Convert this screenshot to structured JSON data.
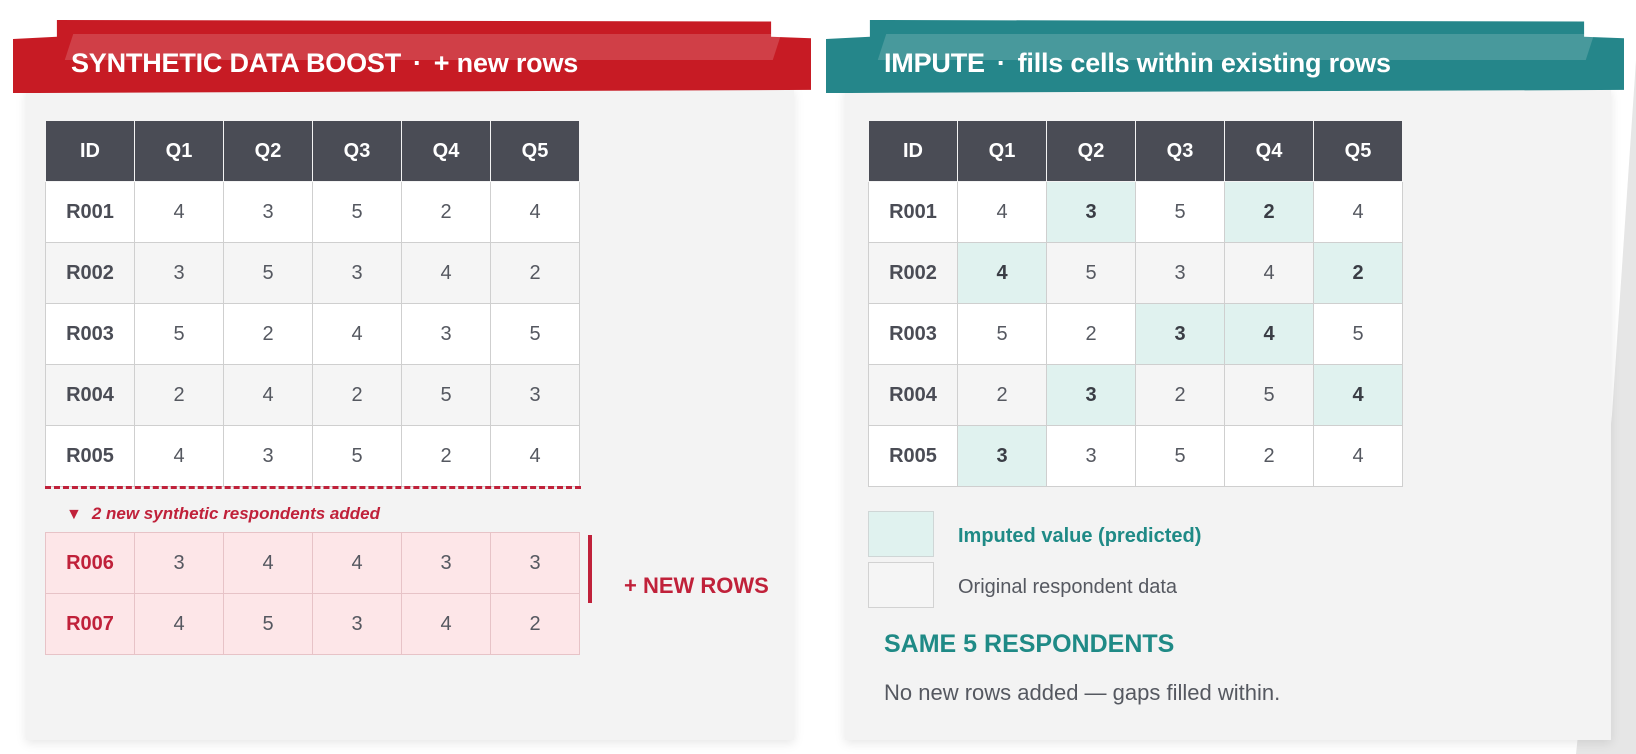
{
  "left": {
    "title": "SYNTHETIC DATA BOOST",
    "separator": "·",
    "subtitle": "+ new rows",
    "color": "#c71b24",
    "headers": [
      "ID",
      "Q1",
      "Q2",
      "Q3",
      "Q4",
      "Q5"
    ],
    "rows": [
      {
        "id": "R001",
        "values": [
          "4",
          "3",
          "5",
          "2",
          "4"
        ]
      },
      {
        "id": "R002",
        "values": [
          "3",
          "5",
          "3",
          "4",
          "2"
        ]
      },
      {
        "id": "R003",
        "values": [
          "5",
          "2",
          "4",
          "3",
          "5"
        ]
      },
      {
        "id": "R004",
        "values": [
          "2",
          "4",
          "2",
          "5",
          "3"
        ]
      },
      {
        "id": "R005",
        "values": [
          "4",
          "3",
          "5",
          "2",
          "4"
        ]
      }
    ],
    "added_note_marker": "▼",
    "added_note": "2 new synthetic respondents added",
    "new_rows": [
      {
        "id": "R006",
        "values": [
          "3",
          "4",
          "4",
          "3",
          "3"
        ]
      },
      {
        "id": "R007",
        "values": [
          "4",
          "5",
          "3",
          "4",
          "2"
        ]
      }
    ],
    "new_rows_label": "+ NEW ROWS"
  },
  "right": {
    "title": "IMPUTE",
    "separator": "·",
    "subtitle": "fills cells within existing rows",
    "color": "#25868a",
    "headers": [
      "ID",
      "Q1",
      "Q2",
      "Q3",
      "Q4",
      "Q5"
    ],
    "rows": [
      {
        "id": "R001",
        "values": [
          "4",
          "3",
          "5",
          "2",
          "4"
        ],
        "imputed": [
          false,
          true,
          false,
          true,
          false
        ]
      },
      {
        "id": "R002",
        "values": [
          "4",
          "5",
          "3",
          "4",
          "2"
        ],
        "imputed": [
          true,
          false,
          false,
          false,
          true
        ]
      },
      {
        "id": "R003",
        "values": [
          "5",
          "2",
          "3",
          "4",
          "5"
        ],
        "imputed": [
          false,
          false,
          true,
          true,
          false
        ]
      },
      {
        "id": "R004",
        "values": [
          "2",
          "3",
          "2",
          "5",
          "4"
        ],
        "imputed": [
          false,
          true,
          false,
          false,
          true
        ]
      },
      {
        "id": "R005",
        "values": [
          "3",
          "3",
          "5",
          "2",
          "4"
        ],
        "imputed": [
          true,
          false,
          false,
          false,
          false
        ]
      }
    ],
    "legend": {
      "imputed": "Imputed value (predicted)",
      "original": "Original respondent data"
    },
    "summary_title": "SAME 5 RESPONDENTS",
    "summary_text": "No new rows added — gaps filled within."
  }
}
